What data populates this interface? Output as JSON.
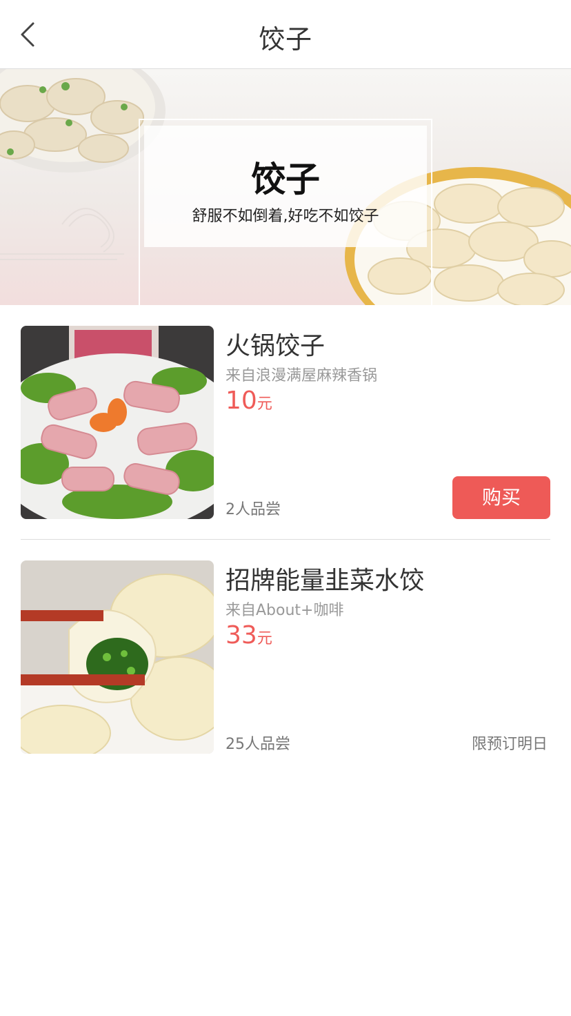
{
  "nav": {
    "title": "饺子",
    "back_icon": "chevron-left-icon"
  },
  "banner": {
    "title": "饺子",
    "subtitle": "舒服不如倒着,好吃不如饺子"
  },
  "items": [
    {
      "name": "火锅饺子",
      "source": "来自浪漫满屋麻辣香锅",
      "price": "10",
      "unit": "元",
      "tasted": "2人品尝",
      "action": "购买"
    },
    {
      "name": "招牌能量韭菜水饺",
      "source": "来自About+咖啡",
      "price": "33",
      "unit": "元",
      "tasted": "25人品尝",
      "note": "限预订明日"
    }
  ],
  "colors": {
    "accent": "#ee5a57",
    "price": "#ef5b58",
    "muted": "#999999",
    "divider": "#dddddd"
  }
}
